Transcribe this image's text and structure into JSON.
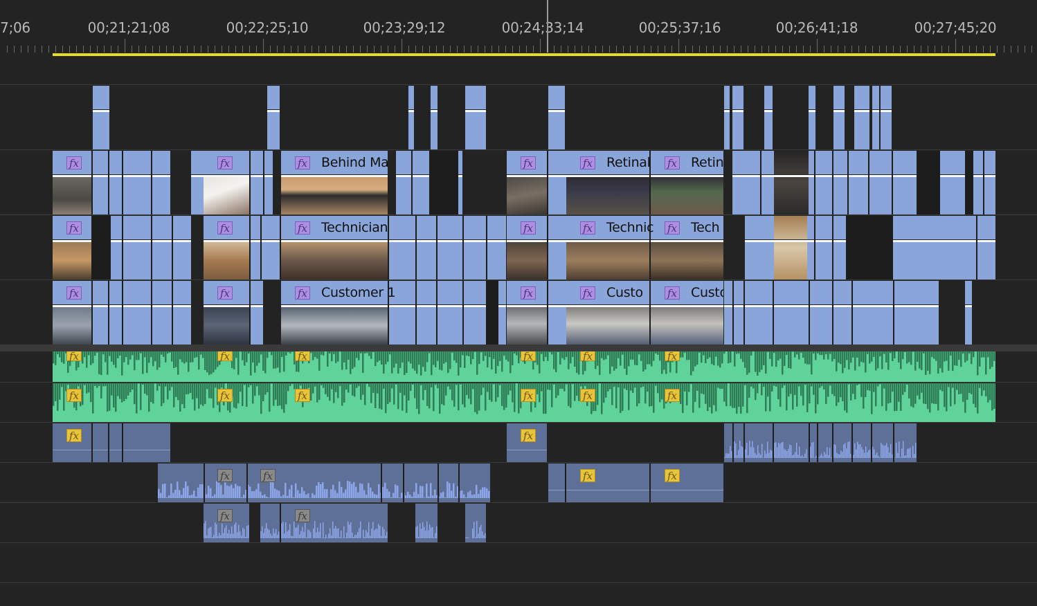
{
  "ruler": {
    "timecodes": [
      {
        "label": "7;06",
        "pos": 0
      },
      {
        "label": "00;21;21;08",
        "pos": 1
      },
      {
        "label": "00;22;25;10",
        "pos": 2
      },
      {
        "label": "00;23;29;12",
        "pos": 3
      },
      {
        "label": "00;24;33;14",
        "pos": 4
      },
      {
        "label": "00;25;37;16",
        "pos": 5
      },
      {
        "label": "00;26;41;18",
        "pos": 6
      },
      {
        "label": "00;27;45;20",
        "pos": 7
      }
    ]
  },
  "clips": {
    "v2_a": "Behind Ma",
    "v2_b": "Retinal",
    "v2_c": "Retin",
    "v1_a": "Technician",
    "v1_b": "Technic",
    "v1_c": "Tech",
    "v0_a": "Customer 1",
    "v0_b": "Custo",
    "v0_c": "Custo"
  },
  "fx_label": "fx",
  "colors": {
    "video_clip": "#8aa5d9",
    "audio_clip": "#5fd39a",
    "audio_clip_muted": "#5e6f98",
    "work_area_bar": "#e5de23",
    "fx_video": "#ad8fe0",
    "fx_audio": "#e8c43a",
    "playhead": "#9a9a9a"
  }
}
